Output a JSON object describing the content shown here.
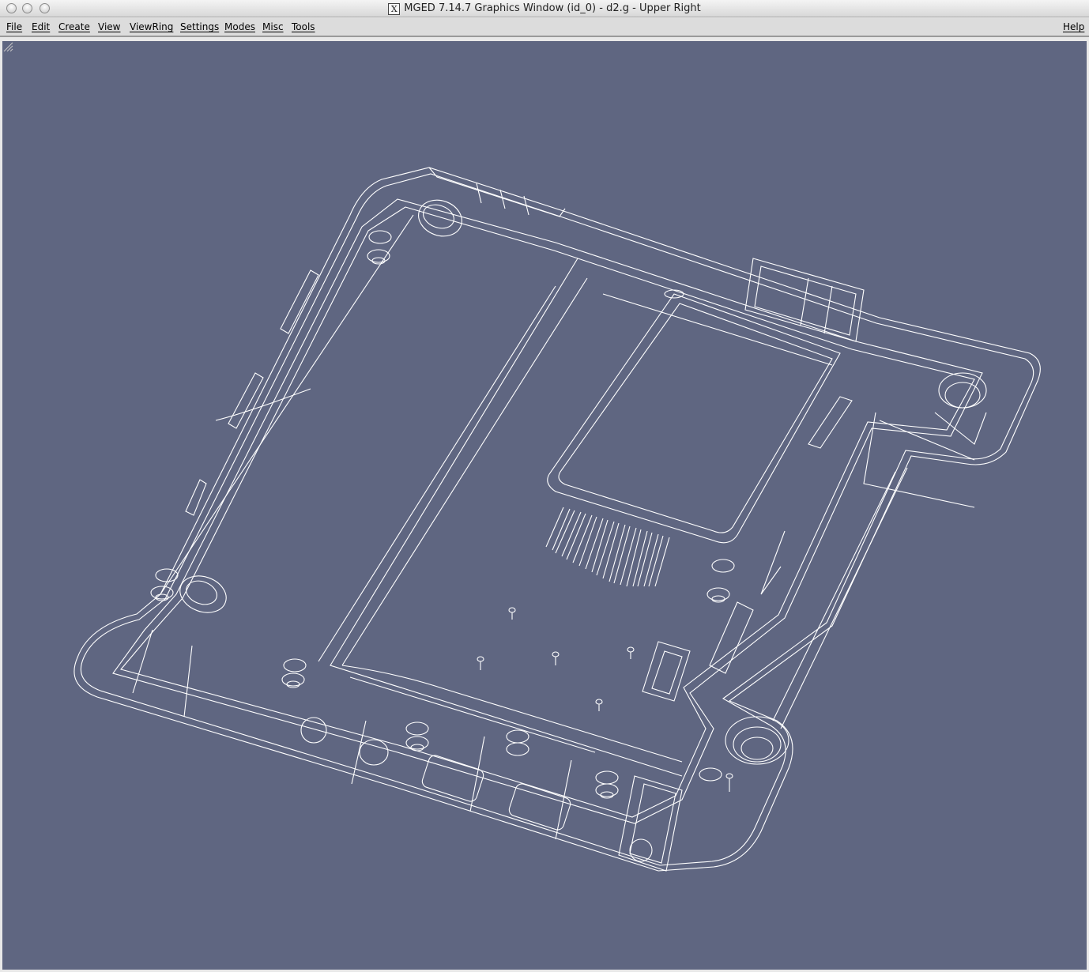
{
  "window": {
    "title": "MGED 7.14.7 Graphics Window (id_0) - d2.g - Upper Right",
    "x_badge": "X"
  },
  "menubar": {
    "file": "File",
    "edit": "Edit",
    "create": "Create",
    "view": "View",
    "viewring": "ViewRing",
    "settings": "Settings",
    "modes": "Modes",
    "misc": "Misc",
    "tools": "Tools",
    "help": "Help"
  },
  "viewport": {
    "background_color": "#5f6681",
    "wireframe_color": "#ffffff",
    "content": "wireframe-model"
  }
}
